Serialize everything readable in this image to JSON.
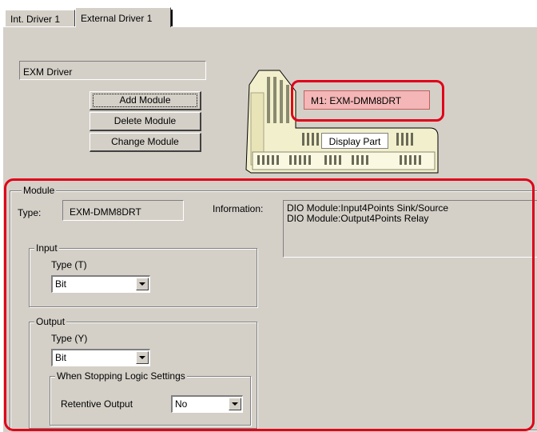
{
  "tabs": [
    "Int. Driver 1",
    "External Driver 1"
  ],
  "driver_name": "EXM Driver",
  "buttons": {
    "add_module": "Add Module",
    "delete_module": "Delete Module",
    "change_module": "Change Module"
  },
  "unit": {
    "module_tag": "M1: EXM-DMM8DRT",
    "display_part": "Display Part"
  },
  "module": {
    "group_label": "Module",
    "type_label": "Type:",
    "type_value": "EXM-DMM8DRT",
    "information_label": "Information:",
    "information_lines": [
      "DIO Module:Input4Points Sink/Source",
      "DIO Module:Output4Points Relay"
    ]
  },
  "input": {
    "group_label": "Input",
    "type_label": "Type (T)",
    "type_value": "Bit"
  },
  "output": {
    "group_label": "Output",
    "type_label": "Type (Y)",
    "type_value": "Bit",
    "stop_group_label": "When Stopping Logic Settings",
    "retentive_label": "Retentive Output",
    "retentive_value": "No"
  },
  "colors": {
    "highlight": "#e0001a",
    "face": "#d4d0c8",
    "module_tag_bg": "#f4b6b6",
    "unit_body": "#f2f0cc"
  }
}
